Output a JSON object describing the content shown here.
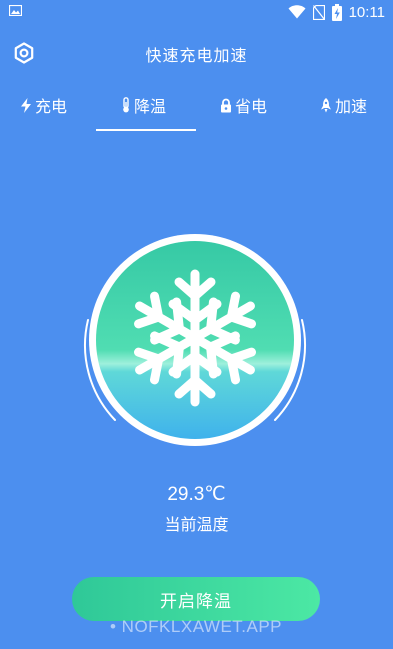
{
  "status_bar": {
    "time": "10:11",
    "icons": [
      "image-icon",
      "wifi-icon",
      "no-sim-icon",
      "battery-charging-icon"
    ]
  },
  "header": {
    "title": "快速充电加速",
    "settings_icon": "settings-icon"
  },
  "tabs": [
    {
      "label": "充电",
      "icon": "lightning-icon",
      "active": false
    },
    {
      "label": "降温",
      "icon": "thermometer-icon",
      "active": true
    },
    {
      "label": "省电",
      "icon": "lock-icon",
      "active": false
    },
    {
      "label": "加速",
      "icon": "rocket-icon",
      "active": false
    }
  ],
  "cooler": {
    "icon": "snowflake-icon"
  },
  "temperature": {
    "value": "29.3℃",
    "label": "当前温度"
  },
  "action": {
    "button_label": "开启降温"
  },
  "watermark": "• NOFKLXAWET.APP",
  "colors": {
    "background": "#4C8FEF",
    "accent_green": "#3FD9A0",
    "text": "#FFFFFF"
  }
}
